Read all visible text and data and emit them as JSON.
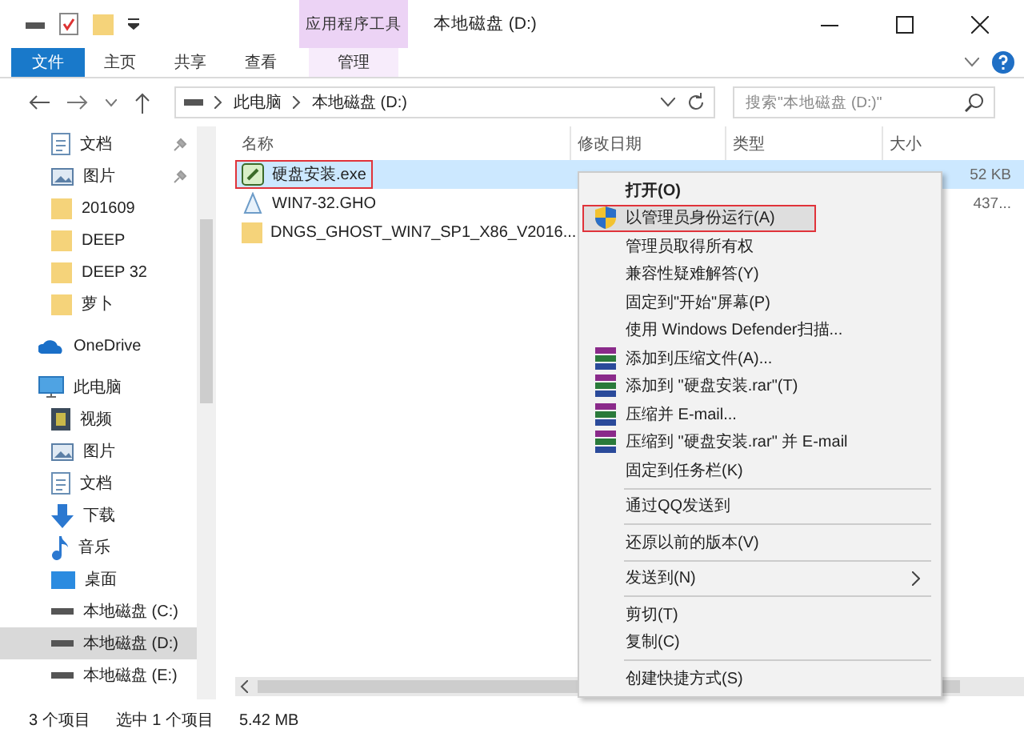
{
  "window": {
    "title": "本地磁盘 (D:)",
    "tool_group": "应用程序工具"
  },
  "ribbon_tabs": [
    {
      "label": "文件",
      "kind": "file",
      "selected": false
    },
    {
      "label": "主页",
      "kind": "plain",
      "selected": false
    },
    {
      "label": "共享",
      "kind": "plain",
      "selected": false
    },
    {
      "label": "查看",
      "kind": "plain",
      "selected": false
    },
    {
      "label": "管理",
      "kind": "contextual",
      "selected": false
    }
  ],
  "address": {
    "crumbs": [
      "此电脑",
      "本地磁盘 (D:)"
    ]
  },
  "search": {
    "placeholder": "搜索\"本地磁盘 (D:)\""
  },
  "sidebar": {
    "sections": [
      {
        "items": [
          {
            "label": "文档",
            "kind": "doc",
            "pinned": true,
            "selected": false
          },
          {
            "label": "图片",
            "kind": "picture",
            "pinned": true,
            "selected": false
          },
          {
            "label": "201609",
            "kind": "folder",
            "pinned": false,
            "selected": false
          },
          {
            "label": "DEEP",
            "kind": "folder",
            "pinned": false,
            "selected": false
          },
          {
            "label": "DEEP 32",
            "kind": "folder",
            "pinned": false,
            "selected": false
          },
          {
            "label": "萝卜",
            "kind": "folder",
            "pinned": false,
            "selected": false
          }
        ]
      },
      {
        "items": [
          {
            "label": "OneDrive",
            "kind": "cloud",
            "pinned": false,
            "selected": false
          }
        ]
      },
      {
        "items": [
          {
            "label": "此电脑",
            "kind": "pc",
            "pinned": false,
            "selected": false
          },
          {
            "label": "视频",
            "kind": "video",
            "pinned": false,
            "selected": false
          },
          {
            "label": "图片",
            "kind": "picture",
            "pinned": false,
            "selected": false
          },
          {
            "label": "文档",
            "kind": "doc",
            "pinned": false,
            "selected": false
          },
          {
            "label": "下载",
            "kind": "download",
            "pinned": false,
            "selected": false
          },
          {
            "label": "音乐",
            "kind": "music",
            "pinned": false,
            "selected": false
          },
          {
            "label": "桌面",
            "kind": "desktop",
            "pinned": false,
            "selected": false
          },
          {
            "label": "本地磁盘 (C:)",
            "kind": "drive",
            "pinned": false,
            "selected": false
          },
          {
            "label": "本地磁盘 (D:)",
            "kind": "drive",
            "pinned": false,
            "selected": true
          },
          {
            "label": "本地磁盘 (E:)",
            "kind": "drive",
            "pinned": false,
            "selected": false
          }
        ]
      }
    ]
  },
  "table": {
    "columns": [
      "名称",
      "修改日期",
      "类型",
      "大小"
    ],
    "rows": [
      {
        "name": "硬盘安装.exe",
        "kind": "exe",
        "size": "52 KB",
        "selected": true,
        "outlined": true
      },
      {
        "name": "WIN7-32.GHO",
        "kind": "gho",
        "size": "437...",
        "selected": false,
        "outlined": false
      },
      {
        "name": "DNGS_GHOST_WIN7_SP1_X86_V2016...",
        "kind": "folder",
        "selected": false,
        "outlined": false
      }
    ]
  },
  "context_menu": {
    "items": [
      {
        "kind": "item",
        "label": "打开(O)",
        "bold": true,
        "hovered": false,
        "outlined": false
      },
      {
        "kind": "shield-item",
        "label": "以管理员身份运行(A)",
        "bold": false,
        "hovered": true,
        "outlined": true
      },
      {
        "kind": "item",
        "label": "管理员取得所有权",
        "bold": false,
        "hovered": false,
        "outlined": false
      },
      {
        "kind": "item",
        "label": "兼容性疑难解答(Y)",
        "bold": false,
        "hovered": false,
        "outlined": false
      },
      {
        "kind": "item",
        "label": "固定到\"开始\"屏幕(P)",
        "bold": false,
        "hovered": false,
        "outlined": false
      },
      {
        "kind": "item",
        "label": "使用 Windows Defender扫描...",
        "bold": false,
        "hovered": false,
        "outlined": false
      },
      {
        "kind": "archive-item",
        "label": "添加到压缩文件(A)...",
        "bold": false,
        "hovered": false,
        "outlined": false
      },
      {
        "kind": "archive-item",
        "label": "添加到 \"硬盘安装.rar\"(T)",
        "bold": false,
        "hovered": false,
        "outlined": false
      },
      {
        "kind": "archive-item",
        "label": "压缩并 E-mail...",
        "bold": false,
        "hovered": false,
        "outlined": false
      },
      {
        "kind": "archive-item",
        "label": "压缩到 \"硬盘安装.rar\" 并 E-mail",
        "bold": false,
        "hovered": false,
        "outlined": false
      },
      {
        "kind": "item",
        "label": "固定到任务栏(K)",
        "bold": false,
        "hovered": false,
        "outlined": false
      },
      {
        "kind": "separator"
      },
      {
        "kind": "item",
        "label": "通过QQ发送到",
        "bold": false,
        "hovered": false,
        "outlined": false
      },
      {
        "kind": "separator"
      },
      {
        "kind": "item",
        "label": "还原以前的版本(V)",
        "bold": false,
        "hovered": false,
        "outlined": false
      },
      {
        "kind": "separator"
      },
      {
        "kind": "submenu-item",
        "label": "发送到(N)",
        "bold": false,
        "hovered": false,
        "outlined": false
      },
      {
        "kind": "separator"
      },
      {
        "kind": "item",
        "label": "剪切(T)",
        "bold": false,
        "hovered": false,
        "outlined": false
      },
      {
        "kind": "item",
        "label": "复制(C)",
        "bold": false,
        "hovered": false,
        "outlined": false
      },
      {
        "kind": "separator"
      },
      {
        "kind": "item",
        "label": "创建快捷方式(S)",
        "bold": false,
        "hovered": false,
        "outlined": false
      }
    ]
  },
  "status_bar": [
    "3 个项目",
    "选中 1 个项目",
    "5.42 MB"
  ]
}
